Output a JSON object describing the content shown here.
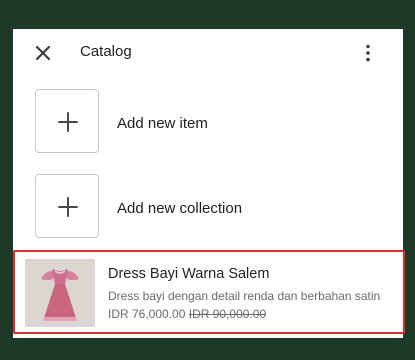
{
  "header": {
    "title": "Catalog",
    "close_icon": "close-icon",
    "more_icon": "more-vert-icon"
  },
  "actions": [
    {
      "label": "Add new item",
      "icon": "plus-icon"
    },
    {
      "label": "Add new collection",
      "icon": "plus-icon"
    }
  ],
  "product": {
    "name": "Dress Bayi Warna Salem",
    "description": "Dress bayi dengan detail renda dan berbahan satin",
    "price": "IDR 76,000.00",
    "old_price": "IDR 90,000.00",
    "thumbnail_icon": "pink-dress-image"
  },
  "colors": {
    "page_background": "#1d3a28",
    "panel_background": "#ffffff",
    "highlight_border": "#d8302f",
    "dress_pink": "#cf6f8e"
  }
}
